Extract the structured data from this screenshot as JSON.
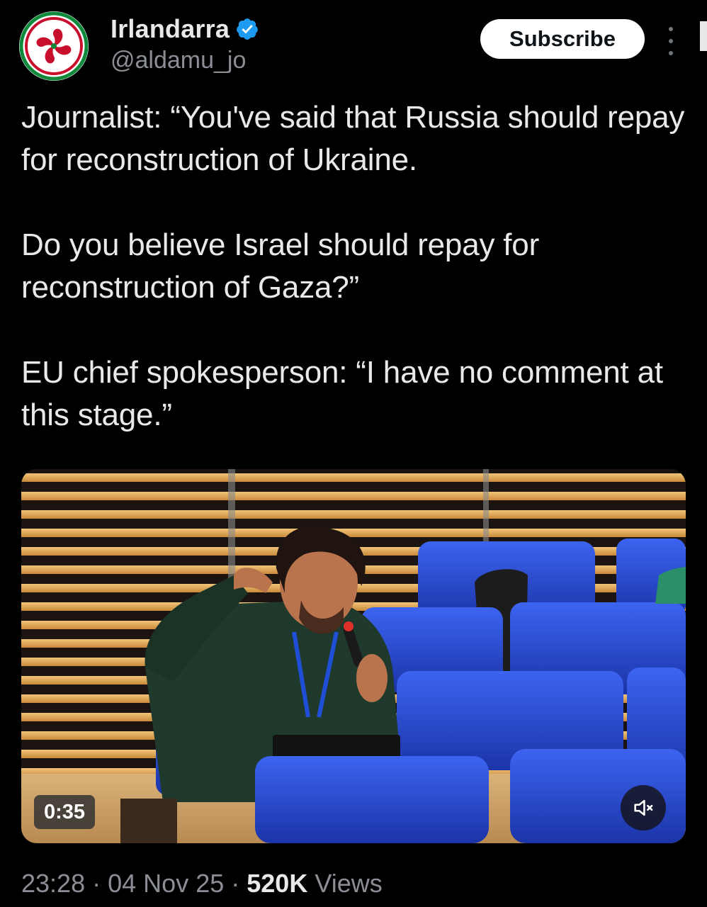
{
  "author": {
    "display_name": "Irlandarra",
    "handle": "@aldamu_jo",
    "verified": true,
    "avatar_icon": "lauburu-icon"
  },
  "actions": {
    "subscribe_label": "Subscribe",
    "more_icon": "more-vertical-icon"
  },
  "tweet": {
    "paragraphs": [
      "Journalist: “You've said that Russia should repay for reconstruction of Ukraine.",
      "Do you believe Israel should repay for reconstruction of Gaza?”",
      "EU chief spokesperson: “I have no comment at this stage.”"
    ]
  },
  "video": {
    "duration": "0:35",
    "muted": true,
    "mute_icon": "speaker-muted-icon"
  },
  "meta": {
    "time": "23:28",
    "separator": "·",
    "date": "04 Nov 25",
    "views_count": "520K",
    "views_label": "Views"
  },
  "colors": {
    "background": "#000000",
    "text_primary": "#e7e9ea",
    "text_secondary": "#8b8f95",
    "verified_blue": "#1d9bf0",
    "seat_blue": "#2a4fd6"
  }
}
